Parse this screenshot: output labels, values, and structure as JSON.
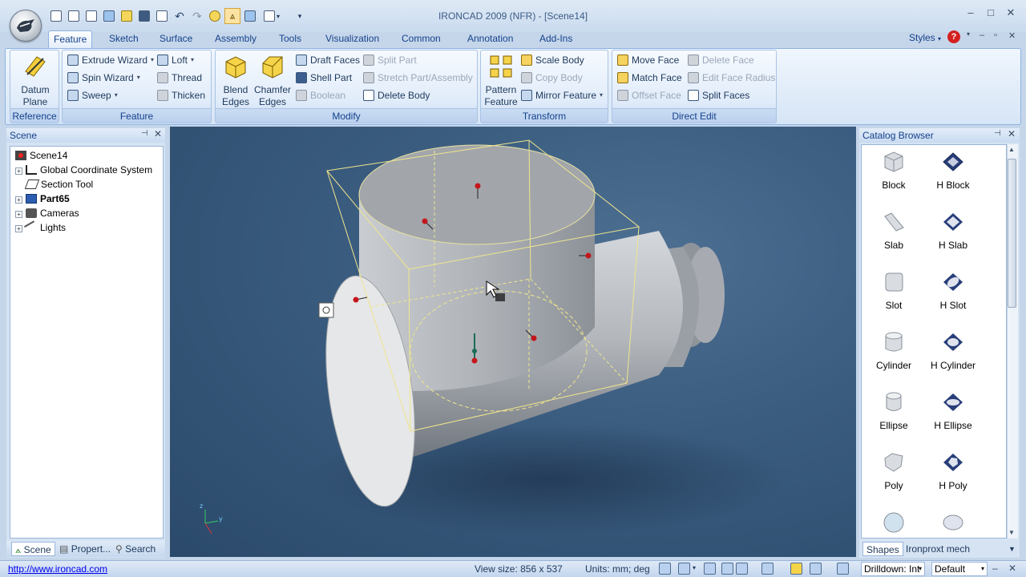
{
  "window": {
    "title": "IRONCAD 2009 (NFR) - [Scene14]",
    "controls": [
      "–",
      "□",
      "✕"
    ]
  },
  "ribbon": {
    "tabs": [
      "Feature",
      "Sketch",
      "Surface",
      "Assembly",
      "Tools",
      "Visualization",
      "Common",
      "Annotation",
      "Add-Ins"
    ],
    "active_tab": "Feature",
    "styles_label": "Styles",
    "groups": {
      "reference": {
        "label": "Reference",
        "datum_plane": "Datum\nPlane"
      },
      "feature": {
        "label": "Feature",
        "extrude_wizard": "Extrude Wizard",
        "spin_wizard": "Spin Wizard",
        "sweep": "Sweep",
        "loft": "Loft",
        "thread": "Thread",
        "thicken": "Thicken"
      },
      "modify": {
        "label": "Modify",
        "blend_edges": "Blend\nEdges",
        "chamfer_edges": "Chamfer\nEdges",
        "draft_faces": "Draft Faces",
        "shell_part": "Shell Part",
        "boolean": "Boolean",
        "split_part": "Split Part",
        "stretch_part": "Stretch Part/Assembly",
        "delete_body": "Delete Body"
      },
      "transform": {
        "label": "Transform",
        "pattern_feature": "Pattern\nFeature",
        "scale_body": "Scale Body",
        "copy_body": "Copy Body",
        "mirror_feature": "Mirror Feature"
      },
      "direct_edit": {
        "label": "Direct Edit",
        "move_face": "Move Face",
        "match_face": "Match Face",
        "offset_face": "Offset Face",
        "delete_face": "Delete Face",
        "edit_face_radius": "Edit Face Radius",
        "split_faces": "Split Faces"
      }
    }
  },
  "scene_panel": {
    "title": "Scene",
    "tree": [
      {
        "label": "Scene14",
        "icon": "scene-icon",
        "bold": false
      },
      {
        "label": "Global Coordinate System",
        "icon": "coordinate-system-icon",
        "bold": false
      },
      {
        "label": "Section Tool",
        "icon": "section-tool-icon",
        "bold": false
      },
      {
        "label": "Part65",
        "icon": "part-icon",
        "bold": true
      },
      {
        "label": "Cameras",
        "icon": "camera-icon",
        "bold": false
      },
      {
        "label": "Lights",
        "icon": "light-icon",
        "bold": false
      }
    ],
    "bottom_tabs": [
      "Scene",
      "Propert...",
      "Search"
    ]
  },
  "catalog": {
    "title": "Catalog Browser",
    "items": [
      "Block",
      "H Block",
      "Slab",
      "H Slab",
      "Slot",
      "H Slot",
      "Cylinder",
      "H Cylinder",
      "Ellipse",
      "H Ellipse",
      "Poly",
      "H Poly",
      "",
      ""
    ],
    "bottom_tabs": [
      "Shapes",
      "Ironproxt mech"
    ]
  },
  "statusbar": {
    "link": "http://www.ironcad.com",
    "view_size": "View size:  856 x 537",
    "units": "Units: mm; deg",
    "drilldown": "Drilldown: Int",
    "style": "Default"
  },
  "colors": {
    "ribbon_bg": "#dbe7f6",
    "viewport_bg": "#3b5d80",
    "selection_box": "#f0e68c",
    "handle_red": "#c4161c"
  }
}
